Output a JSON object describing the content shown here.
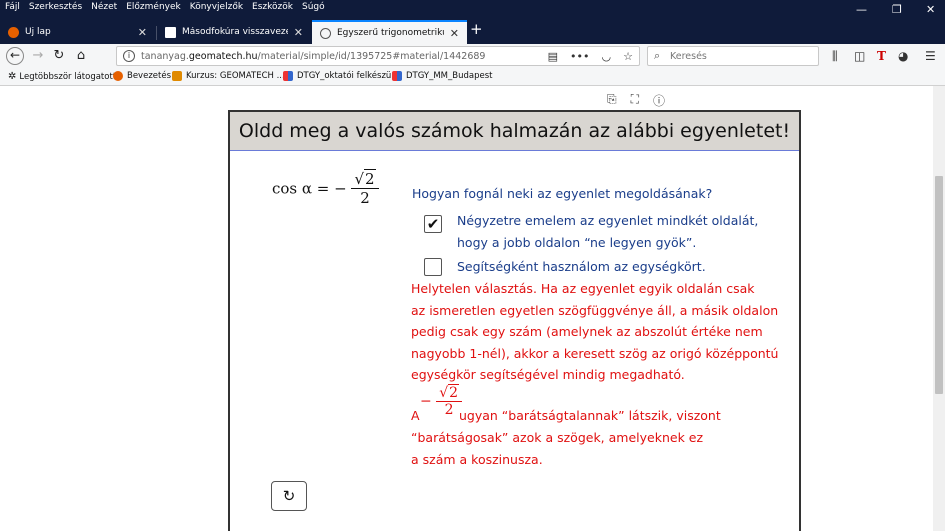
{
  "menu": [
    "Fájl",
    "Szerkesztés",
    "Nézet",
    "Előzmények",
    "Könyvjelzők",
    "Eszközök",
    "Súgó"
  ],
  "tabs": [
    {
      "title": "Új lap",
      "active": false
    },
    {
      "title": "Másodfokúra visszavezethető tr",
      "active": false
    },
    {
      "title": "Egyszerű trigonometrikus egye",
      "active": true
    }
  ],
  "urlbar": {
    "url_prefix": "tananyag.",
    "url_domain": "geomatech.hu",
    "url_rest": "/material/simple/id/1395725#material/1442689"
  },
  "search": {
    "placeholder": "Keresés"
  },
  "bookmarks": [
    {
      "label": "Legtöbbször látogatott"
    },
    {
      "label": "Bevezetés"
    },
    {
      "label": "Kurzus: GEOMATECH ..."
    },
    {
      "label": "DTGY_oktatói felkészü..."
    },
    {
      "label": "DTGY_MM_Budapest"
    }
  ],
  "applet": {
    "heading": "Oldd meg a valós számok halmazán az alábbi egyenletet!",
    "equation": {
      "lhs": "cos α = −",
      "num": "2",
      "den": "2"
    },
    "question": "Hogyan fognál neki az egyenlet megoldásának?",
    "options": [
      {
        "line1": "Négyzetre emelem az egyenlet mindkét oldalát,",
        "line2": "hogy a jobb oldalon “ne legyen gyök”.",
        "checked": true
      },
      {
        "line1": "Segítségként használom az egységkört.",
        "checked": false
      }
    ],
    "feedback_lines": [
      "Helytelen választás. Ha az egyenlet egyik oldalán csak",
      "az ismeretlen egyetlen szögfüggvénye áll, a másik oldalon",
      "pedig csak egy szám (amelynek az abszolút értéke nem",
      "nagyobb 1-nél), akkor a keresett szög az origó középpontú",
      "egységkör segítségével mindig megadható."
    ],
    "feedback_a": "A",
    "feedback_frac": {
      "sign": "−",
      "num": "2",
      "den": "2"
    },
    "feedback_tail": "ugyan “barátságtalannak” látszik, viszont",
    "feedback_lines2": [
      "“barátságosak”  azok a szögek, amelyeknek ez",
      "a szám a koszinusza."
    ]
  }
}
